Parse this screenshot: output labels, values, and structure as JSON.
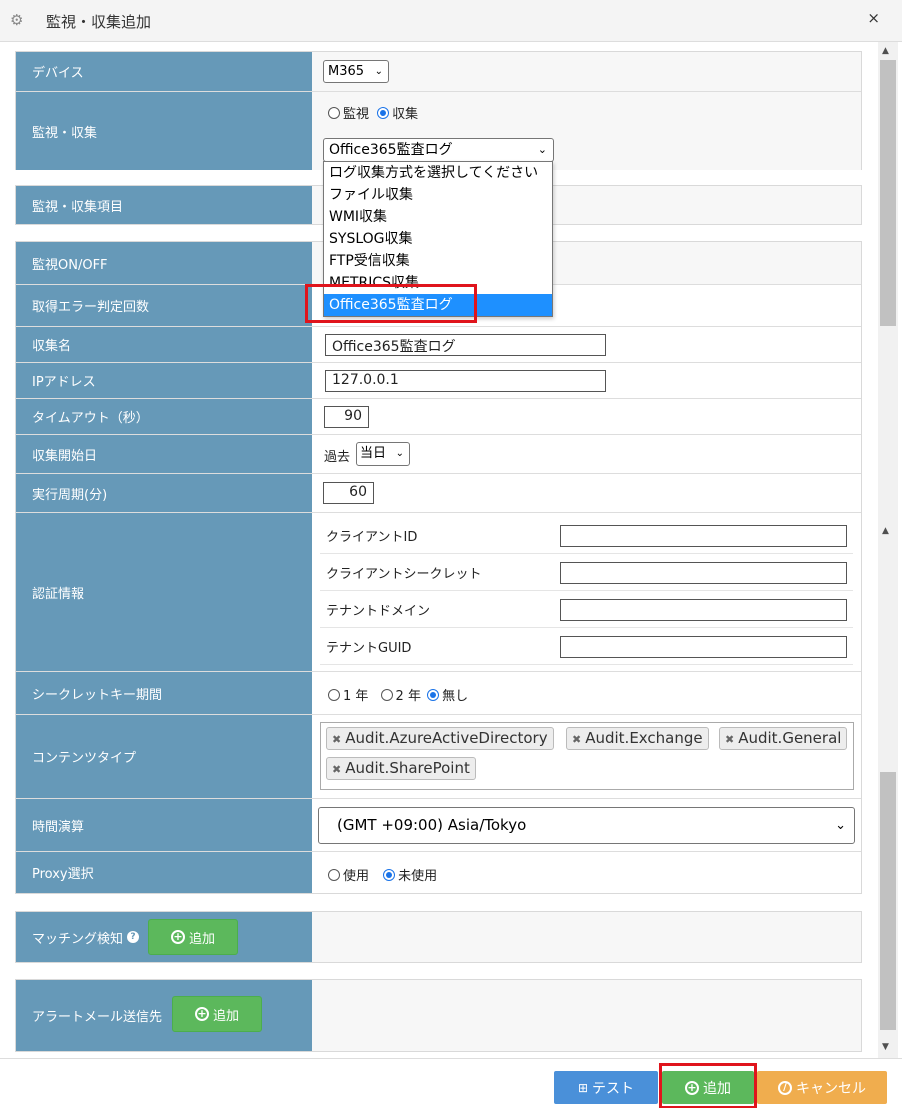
{
  "window": {
    "title": "監視・収集追加",
    "close": "×"
  },
  "rows": {
    "device": {
      "label": "デバイス",
      "value": "M365"
    },
    "monitor_collect": {
      "label": "監視・収集",
      "opt_monitor": "監視",
      "opt_collect": "収集",
      "method": "Office365監査ログ"
    },
    "items": {
      "label": "監視・収集項目"
    },
    "onoff": {
      "label": "監視ON/OFF"
    },
    "error_count": {
      "label": "取得エラー判定回数"
    },
    "name": {
      "label": "収集名",
      "value": "Office365監査ログ"
    },
    "ip": {
      "label": "IPアドレス",
      "value": "127.0.0.1"
    },
    "timeout": {
      "label": "タイムアウト（秒）",
      "value": "90"
    },
    "start": {
      "label": "収集開始日",
      "prefix": "過去",
      "value": "当日"
    },
    "period": {
      "label": "実行周期(分)",
      "value": "60"
    },
    "auth": {
      "label": "認証情報",
      "fields": [
        "クライアントID",
        "クライアントシークレット",
        "テナントドメイン",
        "テナントGUID"
      ]
    },
    "secret_period": {
      "label": "シークレットキー期間",
      "opt1": "1 年",
      "opt2": "2 年",
      "opt3": "無し"
    },
    "content_type": {
      "label": "コンテンツタイプ",
      "tags": [
        "Audit.AzureActiveDirectory",
        "Audit.Exchange",
        "Audit.General",
        "Audit.SharePoint"
      ]
    },
    "timezone": {
      "label": "時間演算",
      "value": "(GMT +09:00) Asia/Tokyo"
    },
    "proxy": {
      "label": "Proxy選択",
      "opt_use": "使用",
      "opt_unused": "未使用"
    }
  },
  "matching": {
    "label": "マッチング検知",
    "help": "?",
    "button": "追加"
  },
  "alert_mail": {
    "label": "アラートメール送信先",
    "button": "追加"
  },
  "dropdown_options": [
    "ログ収集方式を選択してください",
    "ファイル収集",
    "WMI収集",
    "SYSLOG収集",
    "FTP受信収集",
    "METRICS収集",
    "Office365監査ログ"
  ],
  "footer": {
    "test": "テスト",
    "add": "追加",
    "cancel": "キャンセル"
  },
  "colors": {
    "label_bg": "#6699b8",
    "green": "#5cb85c",
    "blue": "#4a90d9",
    "orange": "#f0ad4e",
    "highlight": "#e0141c"
  }
}
